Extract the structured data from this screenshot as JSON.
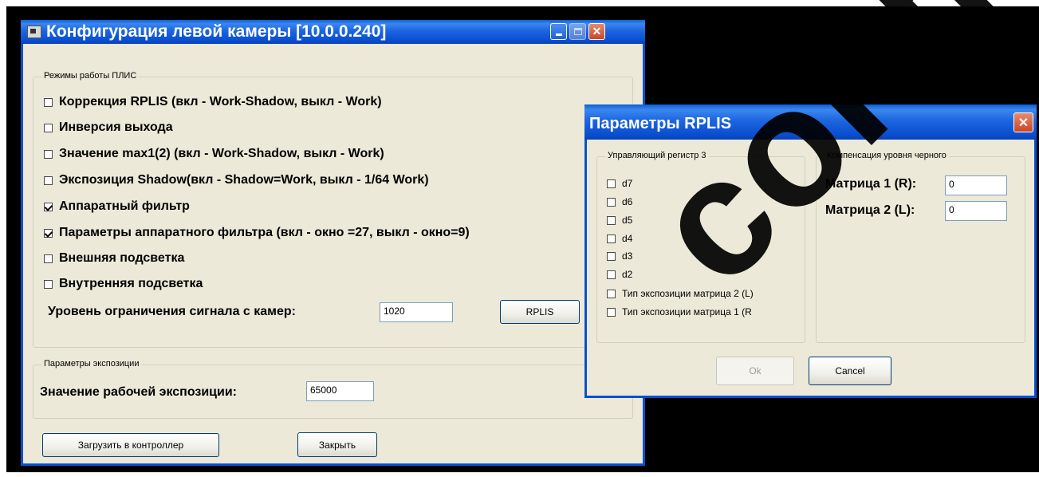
{
  "main_window": {
    "title": "Конфигурация левой камеры [10.0.0.240]",
    "title_buttons": [
      "minimize",
      "maximize",
      "close"
    ],
    "fpga_group": {
      "legend": "Режимы работы ПЛИС",
      "checkboxes": [
        {
          "label": "Коррекция RPLIS (вкл - Work-Shadow, выкл - Work)",
          "checked": false
        },
        {
          "label": "Инверсия выхода",
          "checked": false
        },
        {
          "label": "Значение max1(2) (вкл - Work-Shadow, выкл - Work)",
          "checked": false
        },
        {
          "label": "Экспозиция Shadow(вкл - Shadow=Work, выкл - 1/64 Work)",
          "checked": false
        },
        {
          "label": "Аппаратный фильтр",
          "checked": true
        },
        {
          "label": "Параметры аппаратного фильтра (вкл - окно =27, выкл - окно=9)",
          "checked": true
        },
        {
          "label": "Внешняя подсветка",
          "checked": false
        },
        {
          "label": "Внутренняя подсветка",
          "checked": false
        }
      ],
      "limit_label": "Уровень ограничения сигнала с камер:",
      "limit_value": "1020",
      "rplis_button": "RPLIS"
    },
    "exposure_group": {
      "legend": "Параметры экспозиции",
      "label": "Значение рабочей экспозиции:",
      "value": "65000"
    },
    "load_button": "Загрузить в контроллер",
    "close_button": "Закрыть"
  },
  "rplis_dialog": {
    "title": "Параметры RPLIS",
    "register_group": {
      "legend": "Управляющий регистр 3",
      "checkboxes": [
        {
          "label": "d7",
          "checked": false
        },
        {
          "label": "d6",
          "checked": false
        },
        {
          "label": "d5",
          "checked": false
        },
        {
          "label": "d4",
          "checked": false
        },
        {
          "label": "d3",
          "checked": false
        },
        {
          "label": "d2",
          "checked": false
        },
        {
          "label": "Тип экспозиции матрица 2 (L)",
          "checked": false
        },
        {
          "label": "Тип экспозиции матрица 1 (R",
          "checked": false
        }
      ]
    },
    "black_group": {
      "legend": "Компенсация уровня черного",
      "matrix1_label": "Матрица 1 (R):",
      "matrix1_value": "0",
      "matrix2_label": "Матрица 2 (L):",
      "matrix2_value": "0"
    },
    "ok_button": "Ok",
    "cancel_button": "Cancel"
  },
  "watermark": "confidential",
  "colors": {
    "titlebar": "#0a4fd0",
    "window_bg": "#ece9d8",
    "desktop": "#000000",
    "close_red": "#c9462a"
  }
}
